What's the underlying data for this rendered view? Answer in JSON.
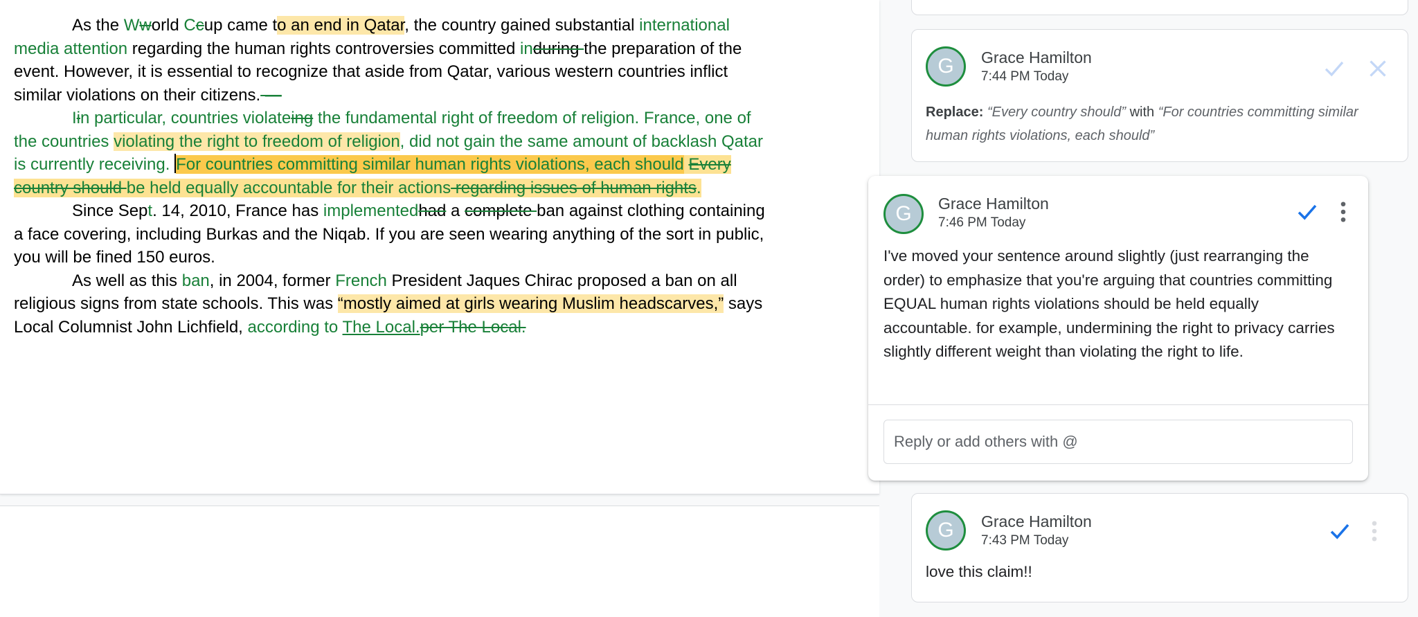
{
  "document": {
    "p1": {
      "t1": "As the ",
      "ins_W": "W",
      "del_w": "w",
      "t2": "orld ",
      "ins_C": "C",
      "del_c": "c",
      "t3": "up came t",
      "hl": "o an end in Qatar",
      "t4": ", the country gained substantial ",
      "ins_media": "international media attention",
      "t5": " regarding the human rights controversies committed ",
      "ins_in": "in",
      "del_during": "during ",
      "t6": "the preparation of the event. However, it is essential to recognize that aside from Qatar, various western countries inflict similar violations on their citizens.",
      "del_dash": " —"
    },
    "p2": {
      "ins_I": "I",
      "del_i": "i",
      "ins_a": "n particular, countries violate",
      "del_ing": "ing",
      "ins_b": " the fundamental right of freedom of religion. France, one of the countries ",
      "hl_vio": "violating the right to freedom of religion",
      "ins_c": ", did not gain the same amount of backlash Qatar is currently receiving. ",
      "hl_for": "For countries committing similar human rights violations, each should",
      "space": " ",
      "del_every": "Every country should ",
      "ins_held": "be held equally accountable for their actions",
      "del_regarding": " regarding issues of human rights",
      "end": "."
    },
    "p3": {
      "t1": "Since Sep",
      "ins_t": "t",
      "t2": ". 14, 2010, France has ",
      "ins_impl": "implemented",
      "del_had": "had",
      "t3": " a ",
      "del_complete": "complete ",
      "t4": "ban against clothing containing a face covering, including Burkas and the Niqab. If you are seen wearing anything of the sort in public, you will be fined 150 euros."
    },
    "p4": {
      "t1": "As well as this ",
      "ins_ban": "ban",
      "t2": ", in 2004, former ",
      "ins_french": "French",
      "t3": " President Jaques Chirac proposed a ban on all religious signs from state schools. This was ",
      "hl_quote": "“mostly aimed at girls wearing Muslim headscarves,”",
      "t4": " says Local Columnist John Lichfield, ",
      "ins_according": "according to ",
      "link_local": "The Local.",
      "del_per": "per The Local."
    }
  },
  "comments": [
    {
      "avatar": "G",
      "author": "Grace Hamilton",
      "time": "7:44 PM Today",
      "replace_label": "Replace:",
      "old_text": "“Every country should”",
      "with_word": "with",
      "new_text": "“For countries committing similar human rights violations, each should”"
    },
    {
      "avatar": "G",
      "author": "Grace Hamilton",
      "time": "7:46 PM Today",
      "text": "I've moved your sentence around slightly (just rearranging the order) to emphasize that you're arguing that countries committing EQUAL human rights violations should be held equally accountable. for example, undermining the right to privacy carries slightly different weight than violating the right to life.",
      "reply_placeholder": "Reply or add others with @"
    },
    {
      "avatar": "G",
      "author": "Grace Hamilton",
      "time": "7:43 PM Today",
      "text": "love this claim!!"
    }
  ],
  "colors": {
    "suggestion_green": "#188038",
    "highlight": "#fde7a9",
    "highlight_active": "#fbc94c",
    "resolve_blue": "#1a73e8",
    "avatar_bg": "#b7cbd6"
  },
  "icons": [
    "check-icon",
    "close-icon",
    "more-vert-icon"
  ]
}
